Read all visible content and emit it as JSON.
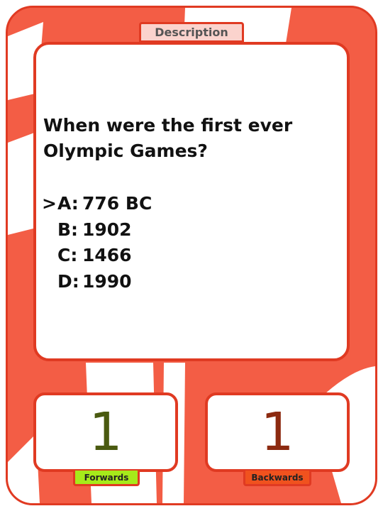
{
  "tab": {
    "label": "Description"
  },
  "question": {
    "text": "When were the first ever Olympic Games?",
    "selected_marker": ">",
    "answers": [
      {
        "letter": "A:",
        "text": "776 BC",
        "selected": true
      },
      {
        "letter": "B:",
        "text": "1902",
        "selected": false
      },
      {
        "letter": "C:",
        "text": "1466",
        "selected": false
      },
      {
        "letter": "D:",
        "text": "1990",
        "selected": false
      }
    ]
  },
  "counters": {
    "forwards": {
      "value": "1",
      "label": "Forwards",
      "color": "#a6ea1a"
    },
    "backwards": {
      "value": "1",
      "label": "Backwards",
      "color": "#f0521e"
    }
  },
  "theme": {
    "border": "#e03a22",
    "card_bg": "#f35d45",
    "stripe": "#ffffff"
  }
}
